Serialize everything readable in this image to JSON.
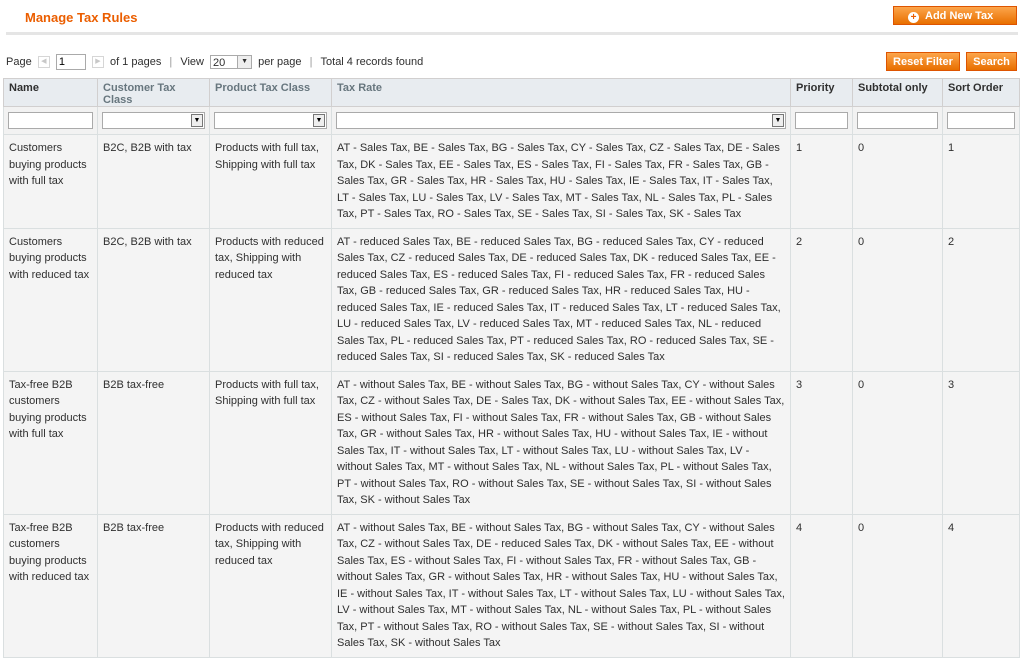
{
  "header": {
    "title": "Manage Tax Rules",
    "add_button": "Add New Tax Rule"
  },
  "pager": {
    "page_label": "Page",
    "page_value": "1",
    "of_pages": "of 1 pages",
    "view_label": "View",
    "per_page_value": "20",
    "per_page_label": "per page",
    "total": "Total 4 records found"
  },
  "actions": {
    "reset_filter": "Reset Filter",
    "search": "Search"
  },
  "columns": {
    "name": "Name",
    "customer_tax_class": "Customer Tax Class",
    "product_tax_class": "Product Tax Class",
    "tax_rate": "Tax Rate",
    "priority": "Priority",
    "subtotal_only": "Subtotal only",
    "sort_order": "Sort Order"
  },
  "rows": [
    {
      "name": "Customers buying products with full tax",
      "customer_tax_class": "B2C, B2B with tax",
      "product_tax_class": "Products with full tax, Shipping with full tax",
      "tax_rate": "AT - Sales Tax, BE - Sales Tax, BG - Sales Tax, CY - Sales Tax, CZ - Sales Tax, DE - Sales Tax, DK - Sales Tax, EE - Sales Tax, ES - Sales Tax, FI - Sales Tax, FR - Sales Tax, GB - Sales Tax, GR - Sales Tax, HR - Sales Tax, HU - Sales Tax, IE - Sales Tax, IT - Sales Tax, LT - Sales Tax, LU - Sales Tax, LV - Sales Tax, MT - Sales Tax, NL - Sales Tax, PL - Sales Tax, PT - Sales Tax, RO - Sales Tax, SE - Sales Tax, SI - Sales Tax, SK - Sales Tax",
      "priority": "1",
      "subtotal_only": "0",
      "sort_order": "1"
    },
    {
      "name": "Customers buying products with reduced tax",
      "customer_tax_class": "B2C, B2B with tax",
      "product_tax_class": "Products with reduced tax, Shipping with reduced tax",
      "tax_rate": "AT - reduced Sales Tax, BE - reduced Sales Tax, BG - reduced Sales Tax, CY - reduced Sales Tax, CZ - reduced Sales Tax, DE - reduced Sales Tax, DK - reduced Sales Tax, EE - reduced Sales Tax, ES - reduced Sales Tax, FI - reduced Sales Tax, FR - reduced Sales Tax, GB - reduced Sales Tax, GR - reduced Sales Tax, HR - reduced Sales Tax, HU - reduced Sales Tax, IE - reduced Sales Tax, IT - reduced Sales Tax, LT - reduced Sales Tax, LU - reduced Sales Tax, LV - reduced Sales Tax, MT - reduced Sales Tax, NL - reduced Sales Tax, PL - reduced Sales Tax, PT - reduced Sales Tax, RO - reduced Sales Tax, SE - reduced Sales Tax, SI - reduced Sales Tax, SK - reduced Sales Tax",
      "priority": "2",
      "subtotal_only": "0",
      "sort_order": "2"
    },
    {
      "name": "Tax-free B2B customers buying products with full tax",
      "customer_tax_class": "B2B tax-free",
      "product_tax_class": "Products with full tax, Shipping with full tax",
      "tax_rate": "AT - without Sales Tax, BE - without Sales Tax, BG - without Sales Tax, CY - without Sales Tax, CZ - without Sales Tax, DE - Sales Tax, DK - without Sales Tax, EE - without Sales Tax, ES - without Sales Tax, FI - without Sales Tax, FR - without Sales Tax, GB - without Sales Tax, GR - without Sales Tax, HR - without Sales Tax, HU - without Sales Tax, IE - without Sales Tax, IT - without Sales Tax, LT - without Sales Tax, LU - without Sales Tax, LV - without Sales Tax, MT - without Sales Tax, NL - without Sales Tax, PL - without Sales Tax, PT - without Sales Tax, RO - without Sales Tax, SE - without Sales Tax, SI - without Sales Tax, SK - without Sales Tax",
      "priority": "3",
      "subtotal_only": "0",
      "sort_order": "3"
    },
    {
      "name": "Tax-free B2B customers buying products with reduced tax",
      "customer_tax_class": "B2B tax-free",
      "product_tax_class": "Products with reduced tax, Shipping with reduced tax",
      "tax_rate": "AT - without Sales Tax, BE - without Sales Tax, BG - without Sales Tax, CY - without Sales Tax, CZ - without Sales Tax, DE - reduced Sales Tax, DK - without Sales Tax, EE - without Sales Tax, ES - without Sales Tax, FI - without Sales Tax, FR - without Sales Tax, GB - without Sales Tax, GR - without Sales Tax, HR - without Sales Tax, HU - without Sales Tax, IE - without Sales Tax, IT - without Sales Tax, LT - without Sales Tax, LU - without Sales Tax, LV - without Sales Tax, MT - without Sales Tax, NL - without Sales Tax, PL - without Sales Tax, PT - without Sales Tax, RO - without Sales Tax, SE - without Sales Tax, SI - without Sales Tax, SK - without Sales Tax",
      "priority": "4",
      "subtotal_only": "0",
      "sort_order": "4"
    }
  ],
  "colors": {
    "accent": "#eb5e00",
    "button": "#f18200",
    "header_bg": "#e8ecf0",
    "row_bg": "#f4f4f4"
  }
}
